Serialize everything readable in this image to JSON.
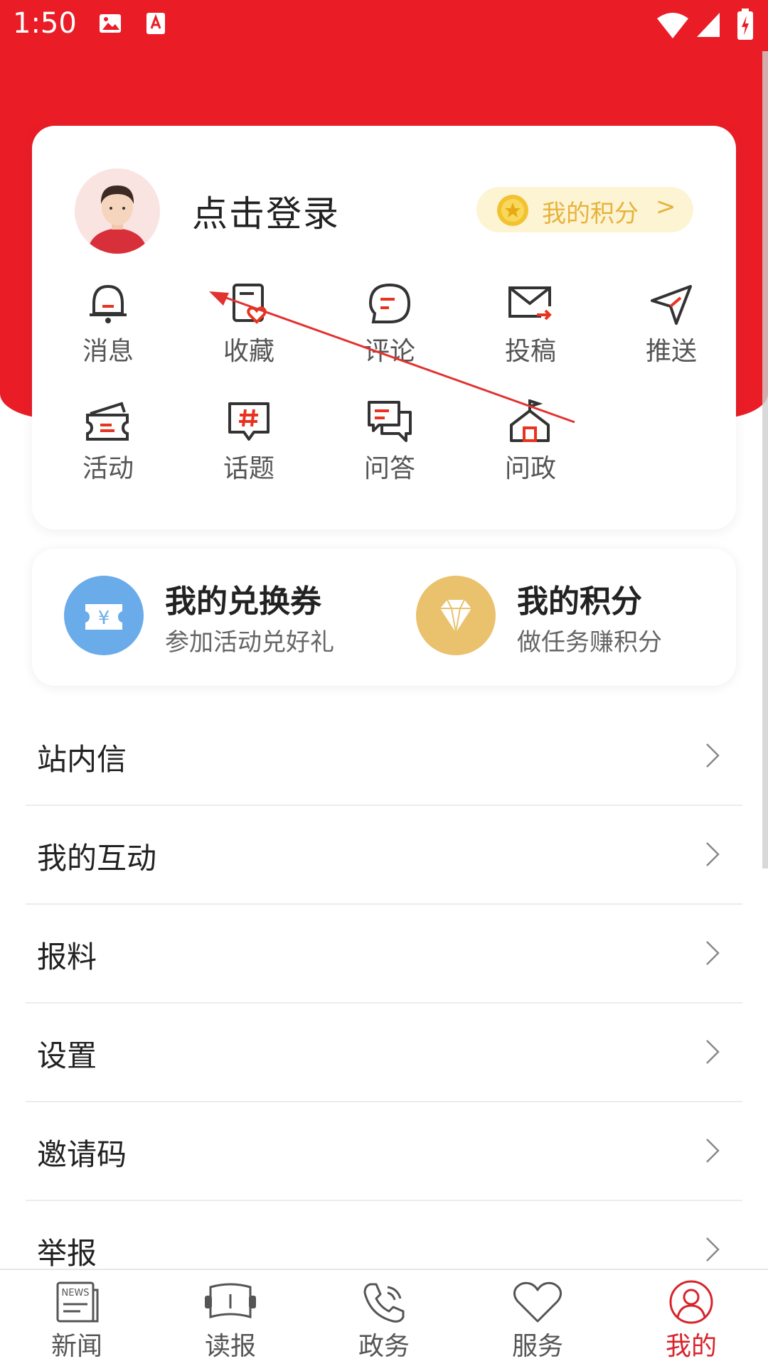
{
  "status_bar": {
    "time": "1:50"
  },
  "profile": {
    "login_text": "点击登录",
    "points_label": "我的积分",
    "points_arrow": ">"
  },
  "grid": [
    {
      "label": "消息",
      "icon": "bell-icon"
    },
    {
      "label": "收藏",
      "icon": "favorite-icon"
    },
    {
      "label": "评论",
      "icon": "comment-icon"
    },
    {
      "label": "投稿",
      "icon": "mail-submit-icon"
    },
    {
      "label": "推送",
      "icon": "send-icon"
    },
    {
      "label": "活动",
      "icon": "ticket-icon"
    },
    {
      "label": "话题",
      "icon": "topic-icon"
    },
    {
      "label": "问答",
      "icon": "qa-icon"
    },
    {
      "label": "问政",
      "icon": "house-flag-icon"
    }
  ],
  "promo": {
    "voucher": {
      "title": "我的兑换券",
      "subtitle": "参加活动兑好礼",
      "color": "#6aabea"
    },
    "points": {
      "title": "我的积分",
      "subtitle": "做任务赚积分",
      "color": "#eac16d"
    }
  },
  "menu": [
    {
      "label": "站内信"
    },
    {
      "label": "我的互动"
    },
    {
      "label": "报料"
    },
    {
      "label": "设置"
    },
    {
      "label": "邀请码"
    },
    {
      "label": "举报"
    }
  ],
  "tabs": [
    {
      "label": "新闻",
      "icon": "news-icon"
    },
    {
      "label": "读报",
      "icon": "newspaper-icon"
    },
    {
      "label": "政务",
      "icon": "phone-icon"
    },
    {
      "label": "服务",
      "icon": "heart-icon"
    },
    {
      "label": "我的",
      "icon": "user-icon",
      "active": true
    }
  ],
  "colors": {
    "brand_red": "#ea1d27",
    "accent_red": "#d7242b",
    "gold": "#e7b33c"
  }
}
